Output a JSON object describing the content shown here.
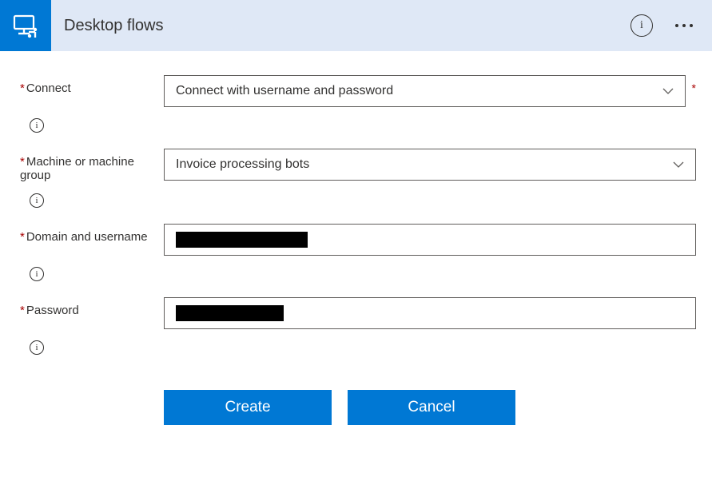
{
  "header": {
    "title": "Desktop flows"
  },
  "form": {
    "connect": {
      "label": "Connect",
      "value": "Connect with username and password"
    },
    "machine": {
      "label": "Machine or machine group",
      "value": "Invoice processing bots"
    },
    "domain": {
      "label": "Domain and username",
      "value": "████████████"
    },
    "password": {
      "label": "Password",
      "value": "██████████"
    }
  },
  "buttons": {
    "create": "Create",
    "cancel": "Cancel"
  }
}
